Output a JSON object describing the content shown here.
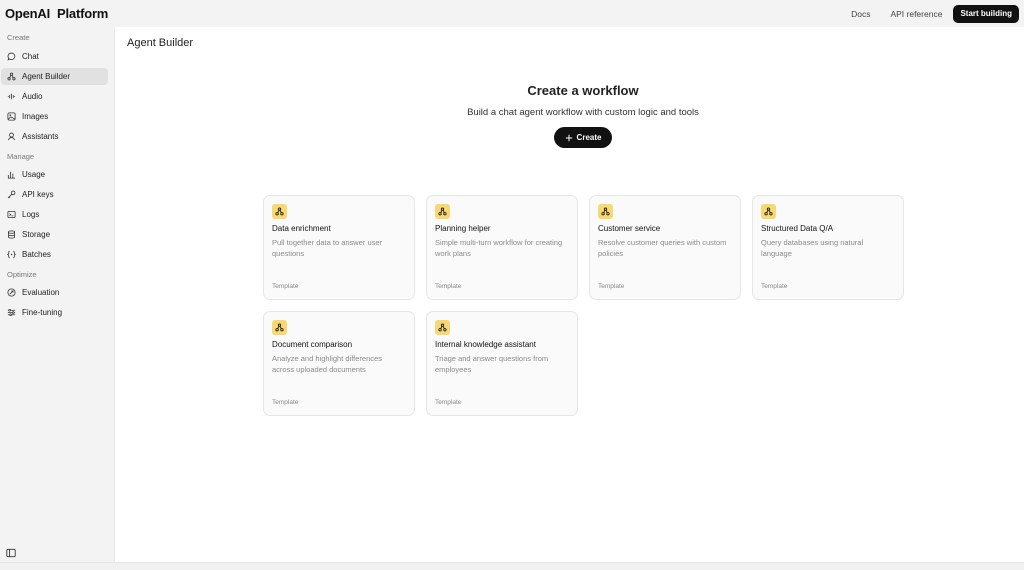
{
  "header": {
    "brand_primary": "OpenAI",
    "brand_secondary": "Platform",
    "docs_label": "Docs",
    "api_reference_label": "API reference",
    "start_building_label": "Start building"
  },
  "sidebar": {
    "sections": [
      {
        "label": "Create",
        "items": [
          {
            "label": "Chat",
            "icon": "chat-icon"
          },
          {
            "label": "Agent Builder",
            "icon": "agent-builder-icon",
            "active": true
          },
          {
            "label": "Audio",
            "icon": "audio-icon"
          },
          {
            "label": "Images",
            "icon": "image-icon"
          },
          {
            "label": "Assistants",
            "icon": "assistants-icon"
          }
        ]
      },
      {
        "label": "Manage",
        "items": [
          {
            "label": "Usage",
            "icon": "bar-chart-icon"
          },
          {
            "label": "API keys",
            "icon": "key-icon"
          },
          {
            "label": "Logs",
            "icon": "logs-icon"
          },
          {
            "label": "Storage",
            "icon": "database-icon"
          },
          {
            "label": "Batches",
            "icon": "batches-icon"
          }
        ]
      },
      {
        "label": "Optimize",
        "items": [
          {
            "label": "Evaluation",
            "icon": "evaluation-icon"
          },
          {
            "label": "Fine-tuning",
            "icon": "sliders-icon"
          }
        ]
      }
    ]
  },
  "main": {
    "page_title": "Agent Builder",
    "hero_title": "Create a workflow",
    "hero_subtitle": "Build a chat agent workflow with custom logic and tools",
    "create_label": "Create",
    "cards": [
      {
        "title": "Data enrichment",
        "desc": "Pull together data to answer user questions",
        "tag": "Template"
      },
      {
        "title": "Planning helper",
        "desc": "Simple multi-turn workflow for creating work plans",
        "tag": "Template"
      },
      {
        "title": "Customer service",
        "desc": "Resolve customer queries with custom policies",
        "tag": "Template"
      },
      {
        "title": "Structured Data Q/A",
        "desc": "Query databases using natural language",
        "tag": "Template"
      },
      {
        "title": "Document comparison",
        "desc": "Analyze and highlight differences across uploaded documents",
        "tag": "Template"
      },
      {
        "title": "Internal knowledge assistant",
        "desc": "Triage and answer questions from employees",
        "tag": "Template"
      }
    ]
  },
  "colors": {
    "accent": "#111111",
    "card_icon_bg": "#f7d873",
    "active_nav_bg": "#e1e1e1"
  }
}
